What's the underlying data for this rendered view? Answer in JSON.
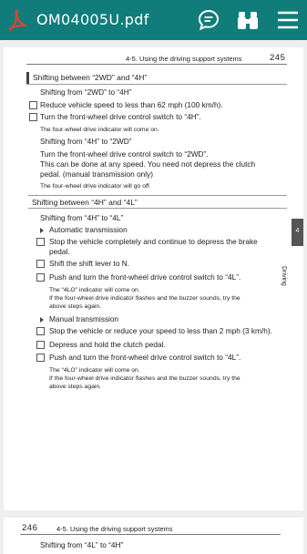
{
  "toolbar": {
    "title": "OM04005U.pdf",
    "icons": [
      "pdf-icon",
      "chat-icon",
      "binoculars-icon",
      "menu-icon"
    ],
    "accent": "#107d7b"
  },
  "page1": {
    "header": "4-5. Using the driving support systems",
    "page_number": "245",
    "side_tab_number": "4",
    "side_tab_label": "Driving",
    "section1": {
      "title": "Shifting between “2WD” and “4H”",
      "sub1": "Shifting from “2WD” to “4H”",
      "step1": "Reduce vehicle speed to less than 62 mph (100 km/h).",
      "step2": "Turn the front-wheel drive control switch to “4H”.",
      "note1": "The four-wheel drive indicator will come on.",
      "sub2": "Shifting from “4H” to “2WD”",
      "para1": "Turn the front-wheel drive control switch to “2WD”.",
      "para2": "This can be done at any speed. You need not depress the clutch",
      "para3": "pedal. (manual transmission only)",
      "note2": "The four-wheel drive indicator will go off."
    },
    "section2": {
      "title": "Shifting between “4H” and “4L”",
      "sub1": "Shifting from “4H” to “4L”",
      "auto_label": "Automatic transmission",
      "a_step1a": "Stop the vehicle completely and continue to depress the brake",
      "a_step1b": "pedal.",
      "a_step2": "Shift the shift lever to N.",
      "a_step3": "Push and turn the front-wheel drive control switch to “4L”.",
      "a_note1": "The “4LO” indicator will come on.",
      "a_note2": "If the four-wheel drive indicator flashes and the buzzer sounds, try the",
      "a_note3": "above steps again.",
      "manual_label": "Manual transmission",
      "m_step1": "Stop the vehicle or reduce your speed to less than 2 mph (3 km/h).",
      "m_step2": "Depress and hold the clutch pedal.",
      "m_step3": "Push and turn the front-wheel drive control switch to “4L”.",
      "m_note1": "The “4LO” indicator will come on.",
      "m_note2": "If the four-wheel drive indicator flashes and the buzzer sounds, try the",
      "m_note3": "above steps again."
    }
  },
  "page2": {
    "page_number": "246",
    "header": "4-5. Using the driving support systems",
    "partial_line": "Shifting from “4L” to “4H”"
  }
}
